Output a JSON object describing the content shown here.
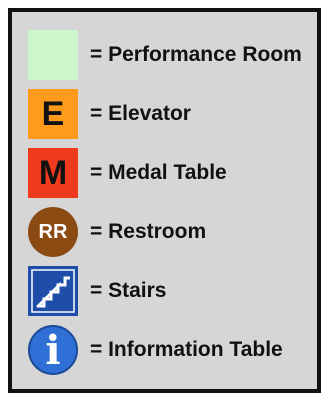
{
  "legend": {
    "items": [
      {
        "id": "performance-room",
        "label": "= Performance Room",
        "symbol_text": "",
        "shape": "square",
        "color": "#ccf6cc",
        "icon": "green-square-icon"
      },
      {
        "id": "elevator",
        "label": "= Elevator",
        "symbol_text": "E",
        "shape": "square",
        "color": "#ff9a1a",
        "icon": "elevator-icon"
      },
      {
        "id": "medal-table",
        "label": "= Medal Table",
        "symbol_text": "M",
        "shape": "square",
        "color": "#f03a1e",
        "icon": "medal-table-icon"
      },
      {
        "id": "restroom",
        "label": "= Restroom",
        "symbol_text": "RR",
        "shape": "circle",
        "color": "#8b4a12",
        "icon": "restroom-icon"
      },
      {
        "id": "stairs",
        "label": "= Stairs",
        "symbol_text": "",
        "shape": "square",
        "color": "#1f4ea8",
        "icon": "stairs-icon"
      },
      {
        "id": "information-table",
        "label": "= Information Table",
        "symbol_text": "i",
        "shape": "circle",
        "color": "#2f6fd6",
        "icon": "information-icon"
      }
    ]
  }
}
